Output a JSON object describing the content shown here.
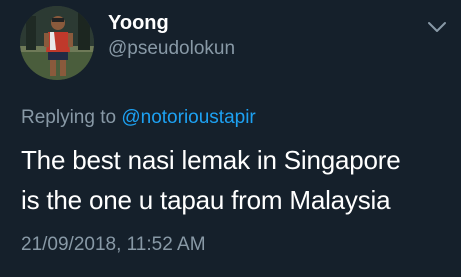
{
  "author": {
    "display_name": "Yoong",
    "handle": "@pseudolokun",
    "avatar_icon": "profile-photo"
  },
  "reply": {
    "prefix": "Replying to",
    "to_handle": "@notorioustapir"
  },
  "tweet": {
    "lines": [
      "The best nasi lemak in Singapore",
      "is the one u tapau from Malaysia"
    ],
    "timestamp": "21/09/2018, 11:52 AM"
  },
  "menu": {
    "icon": "chevron-down-icon"
  },
  "colors": {
    "background": "#15202b",
    "primary_text": "#ffffff",
    "secondary_text": "#8899a6",
    "link": "#1da1f2"
  }
}
